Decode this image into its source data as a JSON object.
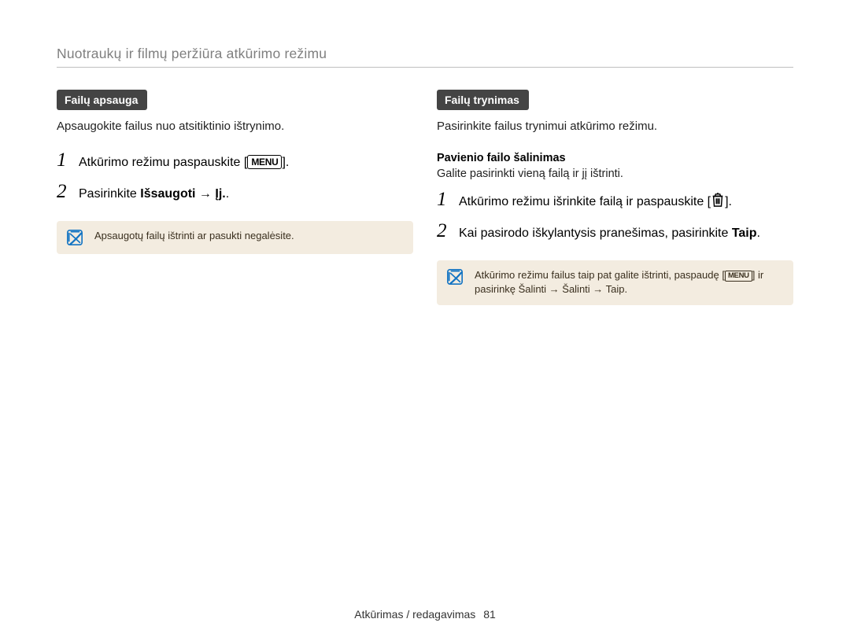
{
  "header": {
    "title": "Nuotraukų ir filmų peržiūra atkūrimo režimu"
  },
  "left": {
    "tag": "Failų apsauga",
    "lead": "Apsaugokite failus nuo atsitiktinio ištrynimo.",
    "steps": {
      "s1_a": "Atkūrimo režimu paspauskite [",
      "menu": "MENU",
      "s1_b": "].",
      "s2_a": "Pasirinkite ",
      "s2_bold": "Išsaugoti",
      "s2_arrow": " → ",
      "s2_opt": "Įj.",
      "s2_suffix": "."
    },
    "note": "Apsaugotų failų ištrinti ar pasukti negalėsite."
  },
  "right": {
    "tag": "Failų trynimas",
    "lead": "Pasirinkite failus trynimui atkūrimo režimu.",
    "subhead": "Pavienio failo šalinimas",
    "subtext": "Galite pasirinkti vieną failą ir jį ištrinti.",
    "steps": {
      "s1_a": "Atkūrimo režimu išrinkite failą ir paspauskite [",
      "s1_b": "].",
      "s2_a": "Kai pasirodo iškylantysis pranešimas, pasirinkite ",
      "s2_bold": "Taip",
      "s2_suffix": "."
    },
    "note_a": "Atkūrimo režimu failus taip pat galite ištrinti, paspaudę [",
    "note_menu": "MENU",
    "note_b": "] ir pasirinkę ",
    "note_bold": "Šalinti → Šalinti → Taip",
    "note_suffix": "."
  },
  "footer": {
    "section": "Atkūrimas / redagavimas",
    "page": "81"
  }
}
